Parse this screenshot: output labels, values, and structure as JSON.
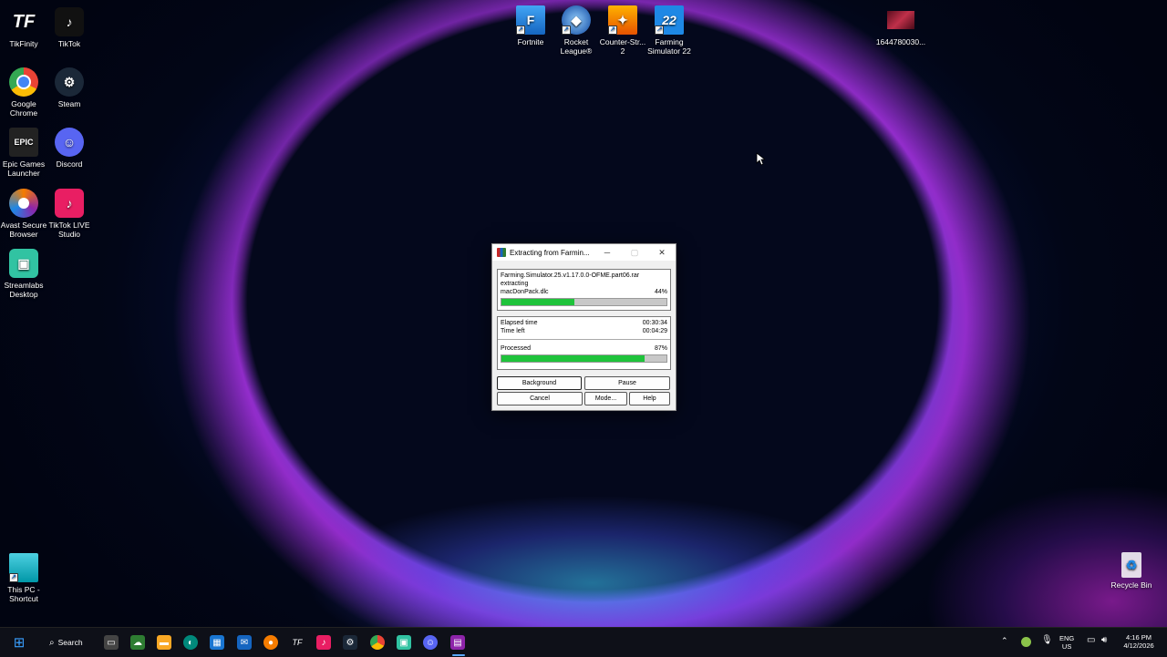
{
  "desktop": {
    "left_icons": [
      {
        "label": "TikFinity",
        "icon": "tikfinity-icon",
        "glyph": "TF",
        "color": "#e91e63"
      },
      {
        "label": "TikTok",
        "icon": "tiktok-icon",
        "glyph": "♪",
        "color": "#111111"
      },
      {
        "label": "Google Chrome",
        "icon": "chrome-icon",
        "glyph": "●",
        "color": "#4caf50"
      },
      {
        "label": "Steam",
        "icon": "steam-icon",
        "glyph": "⚙",
        "color": "#1b2838"
      },
      {
        "label": "Epic Games Launcher",
        "icon": "epic-games-icon",
        "glyph": "EPIC",
        "color": "#222222"
      },
      {
        "label": "Discord",
        "icon": "discord-icon",
        "glyph": "☺",
        "color": "#5865f2"
      },
      {
        "label": "Avast Secure Browser",
        "icon": "avast-browser-icon",
        "glyph": "●",
        "color": "#f57c00"
      },
      {
        "label": "TikTok LIVE Studio",
        "icon": "tiktok-live-icon",
        "glyph": "♪",
        "color": "#e91e63"
      },
      {
        "label": "Streamlabs Desktop",
        "icon": "streamlabs-icon",
        "glyph": "▣",
        "color": "#31c3a2"
      },
      {
        "label": "This PC - Shortcut",
        "icon": "this-pc-icon",
        "glyph": "▭",
        "color": "#26c6da"
      }
    ],
    "top_icons": [
      {
        "label": "Fortnite",
        "icon": "fortnite-icon",
        "glyph": "F",
        "color": "#1e88e5"
      },
      {
        "label": "Rocket League®",
        "icon": "rocket-league-icon",
        "glyph": "◆",
        "color": "#1565c0"
      },
      {
        "label": "Counter-Str... 2",
        "icon": "counter-strike-icon",
        "glyph": "✦",
        "color": "#f9a825"
      },
      {
        "label": "Farming Simulator 22",
        "icon": "farming-simulator-icon",
        "glyph": "22",
        "color": "#1e88e5"
      },
      {
        "label": "1644780030...",
        "icon": "image-file-icon",
        "glyph": "",
        "color": "#a0203a"
      }
    ],
    "recycle_bin": {
      "label": "Recycle Bin",
      "icon": "recycle-bin-icon",
      "glyph": "♻"
    }
  },
  "dialog": {
    "title": "Extracting from Farmin...",
    "archive_name": "Farming.Simulator.25.v1.17.0.0-OFME.part06.rar",
    "action": "extracting",
    "current_file": "macDonPack.dlc",
    "file_percent_label": "44%",
    "file_progress": 0.44,
    "elapsed_label": "Elapsed time",
    "elapsed_value": "00:30:34",
    "time_left_label": "Time left",
    "time_left_value": "00:04:29",
    "processed_label": "Processed",
    "processed_percent_label": "87%",
    "processed_progress": 0.87,
    "buttons": {
      "background": "Background",
      "pause": "Pause",
      "cancel": "Cancel",
      "mode": "Mode...",
      "help": "Help"
    },
    "window_controls": {
      "minimize": "─",
      "maximize": "▢",
      "close": "✕"
    }
  },
  "taskbar": {
    "search_label": "Search",
    "apps": [
      {
        "icon": "start-icon",
        "glyph": "⊞",
        "color": "#1e90ff"
      },
      {
        "icon": "task-view-icon",
        "glyph": "▭",
        "color": "#555555"
      },
      {
        "icon": "widgets-icon",
        "glyph": "☁",
        "color": "#2e7d32"
      },
      {
        "icon": "file-explorer-icon",
        "glyph": "▬",
        "color": "#f9a825"
      },
      {
        "icon": "edge-icon",
        "glyph": "◐",
        "color": "#00897b"
      },
      {
        "icon": "store-icon",
        "glyph": "▦",
        "color": "#1976d2"
      },
      {
        "icon": "mail-icon",
        "glyph": "✉",
        "color": "#1565c0"
      },
      {
        "icon": "avast-browser-icon",
        "glyph": "●",
        "color": "#f57c00"
      },
      {
        "icon": "tikfinity-icon",
        "glyph": "TF",
        "color": "#e91e63"
      },
      {
        "icon": "tiktok-live-icon",
        "glyph": "♪",
        "color": "#e91e63"
      },
      {
        "icon": "steam-icon",
        "glyph": "⚙",
        "color": "#1b2838"
      },
      {
        "icon": "chrome-icon",
        "glyph": "●",
        "color": "#43a047"
      },
      {
        "icon": "streamlabs-icon",
        "glyph": "▣",
        "color": "#31c3a2"
      },
      {
        "icon": "discord-icon",
        "glyph": "☺",
        "color": "#5865f2"
      },
      {
        "icon": "winrar-icon",
        "glyph": "▤",
        "color": "#8e24aa"
      }
    ],
    "tray": {
      "lang_top": "ENG",
      "lang_bottom": "US",
      "time": "4:16 PM",
      "date": "4/12/2026"
    }
  }
}
